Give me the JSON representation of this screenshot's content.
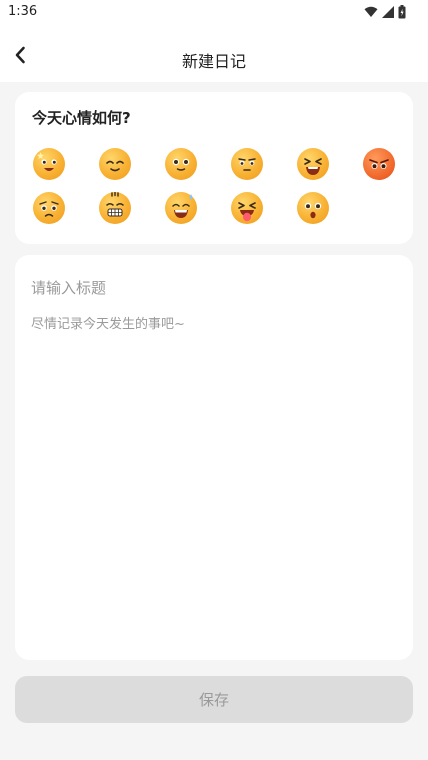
{
  "status_bar": {
    "time": "1:36",
    "icons": [
      "wifi-icon",
      "signal-icon",
      "battery-icon"
    ]
  },
  "header": {
    "back_icon": "back-chevron-icon",
    "title": "新建日记"
  },
  "mood": {
    "title": "今天心情如何?",
    "emojis": [
      {
        "name": "starry-eyes-emoji",
        "color": "#f8b133"
      },
      {
        "name": "content-smile-emoji",
        "color": "#f8b133"
      },
      {
        "name": "wide-eyes-emoji",
        "color": "#f8b133"
      },
      {
        "name": "neutral-emoji",
        "color": "#f8b133"
      },
      {
        "name": "squint-laugh-emoji",
        "color": "#f8b133"
      },
      {
        "name": "angry-emoji",
        "color": "#f26a2e"
      },
      {
        "name": "sad-emoji",
        "color": "#f8b133"
      },
      {
        "name": "grimace-emoji",
        "color": "#f8b133"
      },
      {
        "name": "sweat-smile-emoji",
        "color": "#f8b133"
      },
      {
        "name": "tongue-out-emoji",
        "color": "#f8b133"
      },
      {
        "name": "surprised-emoji",
        "color": "#f8b133"
      }
    ]
  },
  "editor": {
    "title_placeholder": "请输入标题",
    "title_value": "",
    "content_placeholder": "尽情记录今天发生的事吧~",
    "content_value": ""
  },
  "save_button": {
    "label": "保存"
  },
  "colors": {
    "page_background": "#f5f5f5",
    "card_background": "#ffffff",
    "emoji_primary": "#f8b133",
    "emoji_red": "#f26a2e",
    "button_disabled": "#dcdcdc",
    "placeholder_text": "#9a9a9a"
  }
}
